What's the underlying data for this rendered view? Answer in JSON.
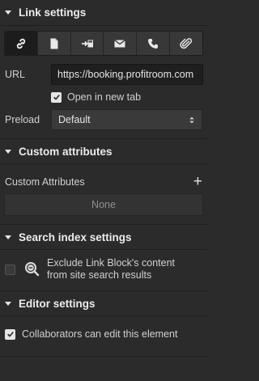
{
  "link_settings": {
    "title": "Link settings",
    "tabs": [
      {
        "name": "url-icon",
        "active": true
      },
      {
        "name": "page-icon",
        "active": false
      },
      {
        "name": "section-icon",
        "active": false
      },
      {
        "name": "email-icon",
        "active": false
      },
      {
        "name": "phone-icon",
        "active": false
      },
      {
        "name": "attachment-icon",
        "active": false
      }
    ],
    "url_label": "URL",
    "url_value": "https://booking.profitroom.com",
    "new_tab_label": "Open in new tab",
    "new_tab_checked": true,
    "preload_label": "Preload",
    "preload_value": "Default"
  },
  "custom_attributes": {
    "title": "Custom attributes",
    "label": "Custom Attributes",
    "add_symbol": "+",
    "empty_text": "None"
  },
  "search_index": {
    "title": "Search index settings",
    "exclude_label_line1": "Exclude Link Block's content",
    "exclude_label_line2": "from site search results",
    "exclude_checked": false
  },
  "editor_settings": {
    "title": "Editor settings",
    "collaborators_label": "Collaborators can edit this element",
    "collaborators_checked": true
  },
  "colors": {
    "panel_bg": "#2b2b2b",
    "input_bg": "#1f1f1f",
    "text": "#d9d9d9"
  }
}
